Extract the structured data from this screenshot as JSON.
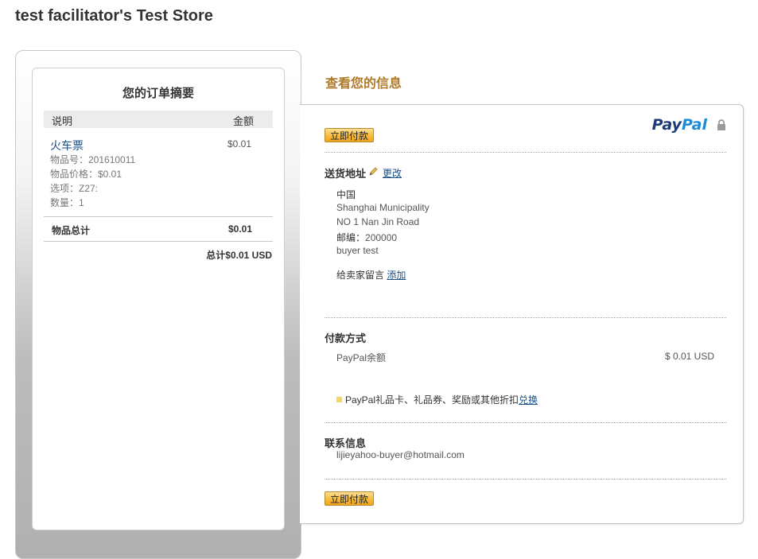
{
  "store": {
    "title": "test facilitator's Test Store"
  },
  "summary": {
    "title": "您的订单摘要",
    "col_desc": "说明",
    "col_amount": "金额",
    "item": {
      "name": "火车票",
      "price": "$0.01",
      "number": "物品号：201610011",
      "unit_price": "物品价格：$0.01",
      "option": "选项：Z27:",
      "quantity": "数量：1"
    },
    "subtotal_label": "物品总计",
    "subtotal_value": "$0.01",
    "total": "总计$0.01 USD"
  },
  "review": {
    "title": "查看您的信息",
    "pay_button": "立即付款",
    "brand_pay": "Pay",
    "brand_pal": "Pal",
    "shipping": {
      "label": "送货地址",
      "edit": "更改",
      "country": "中国",
      "region": "Shanghai Municipality",
      "street": "NO 1 Nan Jin Road",
      "zip_label": "邮编：",
      "zip": "200000",
      "name": "buyer test",
      "note_label": "给卖家留言",
      "note_add": "添加"
    },
    "payment": {
      "label": "付款方式",
      "method": "PayPal余额",
      "amount": "$ 0.01 USD",
      "gift_text": "PayPal礼品卡、礼品券、奖励或其他折扣",
      "gift_link": "兑换"
    },
    "contact": {
      "label": "联系信息",
      "email": "lijieyahoo-buyer@hotmail.com"
    }
  },
  "colors": {
    "title_accent": "#b07a2b",
    "link": "#1a4f87",
    "button": "#f7b936",
    "paypal_dark": "#1b3a7a",
    "paypal_light": "#1f8ad7"
  }
}
